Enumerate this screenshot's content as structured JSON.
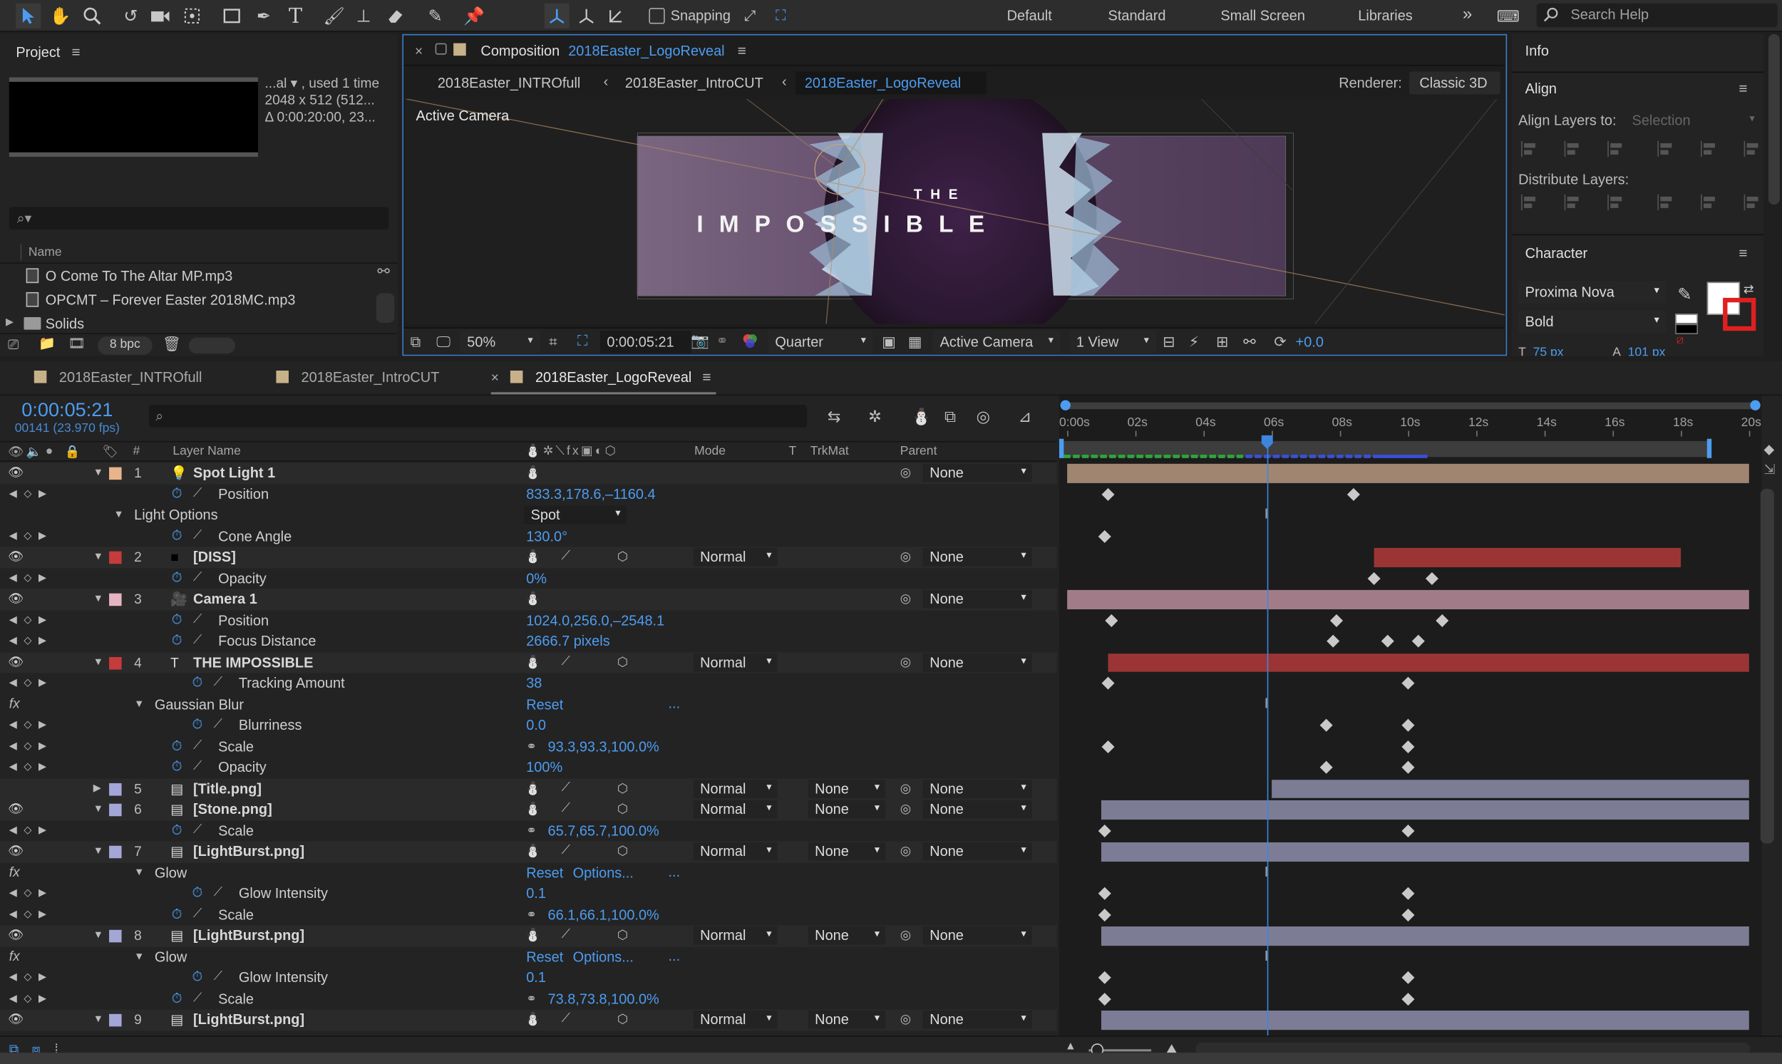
{
  "toolbar": {
    "snapping_label": "Snapping",
    "workspaces": [
      "Default",
      "Standard",
      "Small Screen",
      "Libraries"
    ],
    "overflow": "»",
    "search_placeholder": "Search Help"
  },
  "project": {
    "title": "Project",
    "info_lines": [
      "...al ▾ , used 1 time",
      "2048 x 512  (512...",
      "Δ 0:00:20:00, 23..."
    ],
    "column_name": "Name",
    "items": [
      {
        "name": "O Come To The Altar MP.mp3",
        "type": "audio"
      },
      {
        "name": "OPCMT – Forever Easter 2018MC.mp3",
        "type": "audio"
      },
      {
        "name": "Solids",
        "type": "folder"
      }
    ],
    "bpc": "8 bpc"
  },
  "composition": {
    "close": "×",
    "label": "Composition",
    "name": "2018Easter_LogoReveal",
    "breadcrumbs": [
      "2018Easter_INTROfull",
      "2018Easter_IntroCUT",
      "2018Easter_LogoReveal"
    ],
    "renderer_label": "Renderer:",
    "renderer_value": "Classic 3D",
    "view_label": "Active Camera",
    "logo_top": "T H E",
    "logo_main": "I M P O S S I B L E",
    "zoom": "50%",
    "timecode": "0:00:05:21",
    "resolution": "Quarter",
    "camera": "Active Camera",
    "views": "1 View",
    "exposure": "+0.0"
  },
  "right_panel": {
    "info_title": "Info",
    "align_title": "Align",
    "align_to_label": "Align Layers to:",
    "align_to_value": "Selection",
    "distribute_label": "Distribute Layers:",
    "character_title": "Character",
    "font": "Proxima Nova",
    "style": "Bold",
    "size_partial": "75 px",
    "leading_partial": "101 px"
  },
  "timeline": {
    "tabs": [
      "2018Easter_INTROfull",
      "2018Easter_IntroCUT",
      "2018Easter_LogoReveal"
    ],
    "active_tab_close": "×",
    "timecode": "0:00:05:21",
    "frames": "00141 (23.970 fps)",
    "headers": {
      "num": "#",
      "layer_name": "Layer Name",
      "mode": "Mode",
      "t": "T",
      "trkmat": "TrkMat",
      "parent": "Parent"
    },
    "ruler": [
      "0:00s",
      "02s",
      "04s",
      "06s",
      "08s",
      "10s",
      "12s",
      "14s",
      "16s",
      "18s",
      "20s"
    ],
    "rows": [
      {
        "kind": "layer",
        "num": "1",
        "name": "Spot Light 1",
        "icon": "light-icon",
        "color": "#e9b38c",
        "mode": "",
        "trkmat": "",
        "parent": "None",
        "bar": [
          0,
          20
        ],
        "barcolor": "#a08570"
      },
      {
        "kind": "prop",
        "indent": 1,
        "name": "Position",
        "value": "833.3,178.6,–1160.4",
        "keys": [
          1.2,
          8.4
        ]
      },
      {
        "kind": "group",
        "indent": 0,
        "name": "Light Options",
        "value": "Spot",
        "keys": [],
        "ibeam": true
      },
      {
        "kind": "prop",
        "indent": 1,
        "name": "Cone Angle",
        "value": "130.0°",
        "keys": [
          1.1
        ]
      },
      {
        "kind": "layer",
        "num": "2",
        "name": "[DISS]",
        "icon": "solid-icon",
        "color": "#c63b3b",
        "mode": "Normal",
        "trkmat": "",
        "parent": "None",
        "bar": [
          9,
          18
        ],
        "barcolor": "#9b3535"
      },
      {
        "kind": "prop",
        "indent": 1,
        "name": "Opacity",
        "value": "0%",
        "keys": [
          9,
          10.7
        ]
      },
      {
        "kind": "layer",
        "num": "3",
        "name": "Camera 1",
        "icon": "camera-icon",
        "color": "#e7b3c3",
        "mode": "",
        "trkmat": "",
        "parent": "None",
        "bar": [
          0,
          20
        ],
        "barcolor": "#a17c88"
      },
      {
        "kind": "prop",
        "indent": 1,
        "name": "Position",
        "value": "1024.0,256.0,–2548.1",
        "keys": [
          1.3,
          7.9,
          11
        ]
      },
      {
        "kind": "prop",
        "indent": 1,
        "name": "Focus Distance",
        "value": "2666.7 pixels",
        "keys": [
          7.8,
          9.4,
          10.3
        ]
      },
      {
        "kind": "layer",
        "num": "4",
        "name": "THE IMPOSSIBLE",
        "icon": "text-icon",
        "color": "#c63b3b",
        "mode": "Normal",
        "trkmat": "",
        "parent": "None",
        "bar": [
          1.2,
          20
        ],
        "barcolor": "#9b3535"
      },
      {
        "kind": "prop",
        "indent": 2,
        "name": "Tracking Amount",
        "value": "38",
        "keys": [
          1.2,
          10
        ]
      },
      {
        "kind": "fx",
        "indent": 1,
        "name": "Gaussian Blur",
        "value": "Reset",
        "extra": "...",
        "keys": [],
        "ibeam": true
      },
      {
        "kind": "prop",
        "indent": 2,
        "name": "Blurriness",
        "value": "0.0",
        "keys": [
          7.6,
          10
        ]
      },
      {
        "kind": "prop",
        "indent": 1,
        "name": "Scale",
        "value": "93.3,93.3,100.0%",
        "link": true,
        "keys": [
          1.2,
          10
        ]
      },
      {
        "kind": "prop",
        "indent": 1,
        "name": "Opacity",
        "value": "100%",
        "keys": [
          7.6,
          10
        ]
      },
      {
        "kind": "layer",
        "num": "5",
        "name": "[Title.png]",
        "icon": "footage-icon",
        "color": "#a4a6d8",
        "mode": "Normal",
        "trkmat": "None",
        "parent": "None",
        "bar": [
          6,
          20
        ],
        "barcolor": "#7d7c95"
      },
      {
        "kind": "layer",
        "num": "6",
        "name": "[Stone.png]",
        "icon": "footage-icon",
        "color": "#a4a6d8",
        "mode": "Normal",
        "trkmat": "None",
        "parent": "None",
        "bar": [
          1,
          20
        ],
        "barcolor": "#7d7c95"
      },
      {
        "kind": "prop",
        "indent": 1,
        "name": "Scale",
        "value": "65.7,65.7,100.0%",
        "link": true,
        "keys": [
          1.1,
          10
        ]
      },
      {
        "kind": "layer",
        "num": "7",
        "name": "[LightBurst.png]",
        "icon": "footage-icon",
        "color": "#a4a6d8",
        "mode": "Normal",
        "trkmat": "None",
        "parent": "None",
        "bar": [
          1,
          20
        ],
        "barcolor": "#7d7c95"
      },
      {
        "kind": "fx",
        "indent": 1,
        "name": "Glow",
        "value": "Reset",
        "value2": "Options...",
        "extra": "...",
        "keys": [],
        "ibeam": true
      },
      {
        "kind": "prop",
        "indent": 2,
        "name": "Glow Intensity",
        "value": "0.1",
        "keys": [
          1.1,
          10
        ]
      },
      {
        "kind": "prop",
        "indent": 1,
        "name": "Scale",
        "value": "66.1,66.1,100.0%",
        "link": true,
        "keys": [
          1.1,
          10
        ]
      },
      {
        "kind": "layer",
        "num": "8",
        "name": "[LightBurst.png]",
        "icon": "footage-icon",
        "color": "#a4a6d8",
        "mode": "Normal",
        "trkmat": "None",
        "parent": "None",
        "bar": [
          1,
          20
        ],
        "barcolor": "#7d7c95"
      },
      {
        "kind": "fx",
        "indent": 1,
        "name": "Glow",
        "value": "Reset",
        "value2": "Options...",
        "extra": "...",
        "keys": [],
        "ibeam": true
      },
      {
        "kind": "prop",
        "indent": 2,
        "name": "Glow Intensity",
        "value": "0.1",
        "keys": [
          1.1,
          10
        ]
      },
      {
        "kind": "prop",
        "indent": 1,
        "name": "Scale",
        "value": "73.8,73.8,100.0%",
        "link": true,
        "keys": [
          1.1,
          10
        ]
      },
      {
        "kind": "layer",
        "num": "9",
        "name": "[LightBurst.png]",
        "icon": "footage-icon",
        "color": "#a4a6d8",
        "mode": "Normal",
        "trkmat": "None",
        "parent": "None",
        "bar": [
          1,
          20
        ],
        "barcolor": "#7d7c95"
      }
    ],
    "current_time_seconds": 5.88,
    "duration_seconds": 20,
    "work_area_end_seconds": 18.6
  },
  "colors": {
    "accent": "#4d9cf0",
    "panel": "#232323",
    "bg": "#1f1f1f"
  }
}
